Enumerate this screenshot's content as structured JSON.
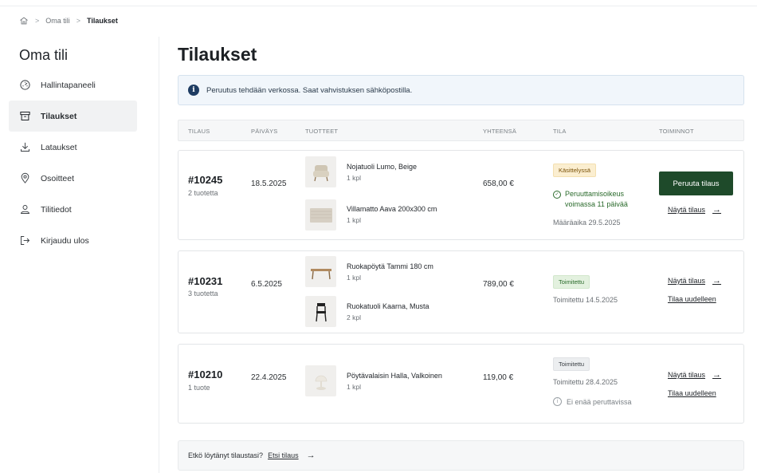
{
  "breadcrumb": {
    "items": [
      "Oma tili",
      "Tilaukset"
    ]
  },
  "sidebar": {
    "title": "Oma tili",
    "items": [
      {
        "label": "Hallintapaneeli",
        "icon": "dashboard-icon"
      },
      {
        "label": "Tilaukset",
        "icon": "box-icon",
        "active": true
      },
      {
        "label": "Lataukset",
        "icon": "download-icon"
      },
      {
        "label": "Osoitteet",
        "icon": "location-pin-icon"
      },
      {
        "label": "Tilitiedot",
        "icon": "user-icon"
      },
      {
        "label": "Kirjaudu ulos",
        "icon": "logout-icon"
      }
    ]
  },
  "main": {
    "title": "Tilaukset",
    "notice": "Peruutus tehdään verkossa. Saat vahvistuksen sähköpostilla.",
    "table_headers": [
      "TILAUS",
      "PÄIVÄYS",
      "TUOTTEET",
      "YHTEENSÄ",
      "TILA",
      "TOIMINNOT"
    ],
    "orders": [
      {
        "number": "#10245",
        "count": "2 tuotetta",
        "date": "18.5.2025",
        "products": [
          {
            "name": "Nojatuoli Lumo, Beige",
            "qty": "1 kpl",
            "icon": "armchair-icon"
          },
          {
            "name": "Villamatto Aava 200x300 cm",
            "qty": "1 kpl",
            "icon": "rug-icon"
          }
        ],
        "total": "658,00 €",
        "status": "Käsittelyssä",
        "note_line1": "Peruuttamisoikeus",
        "note_line2": "voimassa 11 päivää",
        "deadline": "Määräaika 29.5.2025",
        "cancel_label": "Peruuta tilaus",
        "view_label": "Näytä tilaus"
      },
      {
        "number": "#10231",
        "count": "3 tuotetta",
        "date": "6.5.2025",
        "products": [
          {
            "name": "Ruokapöytä Tammi 180 cm",
            "qty": "1 kpl",
            "icon": "table-icon"
          },
          {
            "name": "Ruokatuoli Kaarna, Musta",
            "qty": "2 kpl",
            "icon": "chair-icon"
          }
        ],
        "total": "789,00 €",
        "status": "Toimitettu",
        "delivered": "Toimitettu 14.5.2025",
        "view_label": "Näytä tilaus",
        "reorder_label": "Tilaa uudelleen"
      },
      {
        "number": "#10210",
        "count": "1 tuote",
        "date": "22.4.2025",
        "products": [
          {
            "name": "Pöytävalaisin Halla, Valkoinen",
            "qty": "1 kpl",
            "icon": "lamp-icon"
          }
        ],
        "total": "119,00 €",
        "status": "Toimitettu",
        "delivered": "Toimitettu 28.4.2025",
        "not_cancellable": "Ei enää peruttavissa",
        "view_label": "Näytä tilaus",
        "reorder_label": "Tilaa uudelleen"
      }
    ],
    "footer": {
      "text": "Etkö löytänyt tilaustasi?",
      "link": "Etsi tilaus"
    }
  },
  "colors": {
    "primary_button": "#1e4a2a",
    "processing_badge": "#fbeed0",
    "delivered_badge": "#e3f1df",
    "info": "#1e3c62"
  }
}
